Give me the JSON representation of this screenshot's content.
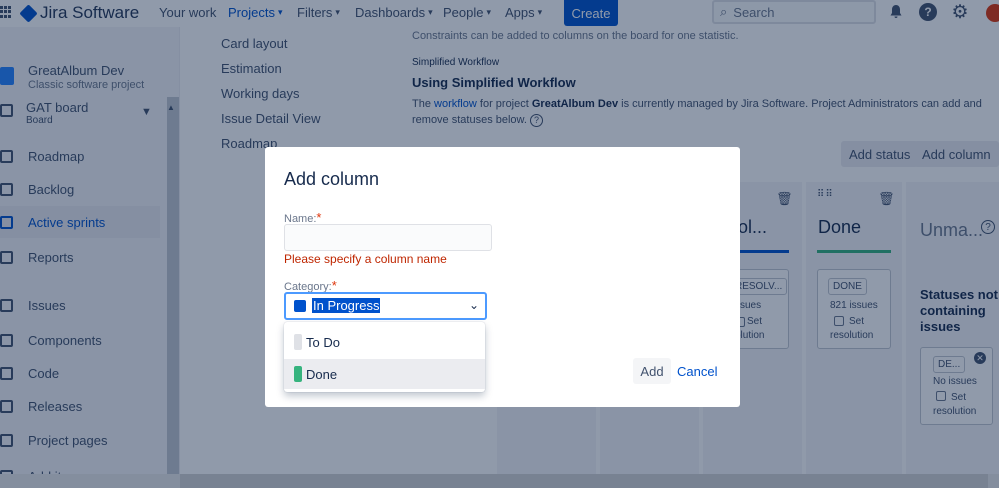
{
  "topnav": {
    "app_name": "Jira Software",
    "items": [
      {
        "label": "Your work",
        "chevron": false
      },
      {
        "label": "Projects",
        "chevron": true,
        "active": true
      },
      {
        "label": "Filters",
        "chevron": true
      },
      {
        "label": "Dashboards",
        "chevron": true
      },
      {
        "label": "People",
        "chevron": true
      },
      {
        "label": "Apps",
        "chevron": true
      }
    ],
    "create_label": "Create",
    "search_placeholder": "Search",
    "help_label": "?"
  },
  "sidebar": {
    "project_name": "GreatAlbum Dev",
    "project_type": "Classic software project",
    "board_name": "GAT board",
    "board_sub": "Board",
    "items": [
      {
        "label": "Roadmap",
        "icon": "roadmap-icon"
      },
      {
        "label": "Backlog",
        "icon": "backlog-icon"
      },
      {
        "label": "Active sprints",
        "icon": "active-sprints-icon",
        "active": true
      },
      {
        "label": "Reports",
        "icon": "reports-icon"
      },
      {
        "label": "Issues",
        "icon": "issues-icon"
      },
      {
        "label": "Components",
        "icon": "components-icon"
      },
      {
        "label": "Code",
        "icon": "code-icon"
      },
      {
        "label": "Releases",
        "icon": "releases-icon"
      },
      {
        "label": "Project pages",
        "icon": "project-pages-icon"
      },
      {
        "label": "Add item",
        "icon": "add-item-icon"
      }
    ]
  },
  "settings_nav": [
    "Card layout",
    "Estimation",
    "Working days",
    "Issue Detail View",
    "Roadmap"
  ],
  "main": {
    "top_note": "Constraints can be added to columns on the board for one statistic.",
    "section_label": "Simplified Workflow",
    "heading": "Using Simplified Workflow",
    "desc_pre": "The",
    "desc_link": "workflow",
    "desc_mid": "for project",
    "desc_project": "GreatAlbum Dev",
    "desc_post": "is currently managed by Jira Software. Project Administrators can add and remove statuses below.",
    "add_status_label": "Add status",
    "add_column_label": "Add column"
  },
  "columns": {
    "resolved_title_fragment": "ol...",
    "resolved_status_label": "RESOLV...",
    "resolved_issues": "ssues",
    "resolved_set_label": "Set",
    "resolved_set_sub": "olution",
    "done_title": "Done",
    "done_status_label": "DONE",
    "done_issues": "821 issues",
    "done_set_label": "Set",
    "done_set_sub": "resolution",
    "unmapped_title": "Unma...",
    "unmapped_help": "?",
    "unmapped_heading": "Statuses not containing issues",
    "unmapped_status_label": "DE...",
    "unmapped_issues": "No issues",
    "unmapped_set_label": "Set",
    "unmapped_set_sub": "resolution"
  },
  "modal": {
    "title": "Add column",
    "name_label": "Name:",
    "required_mark": "*",
    "name_value": "",
    "name_error": "Please specify a column name",
    "category_label": "Category:",
    "category_value": "In Progress",
    "category_options": [
      {
        "label": "To Do",
        "color": "#dfe1e6"
      },
      {
        "label": "Done",
        "color": "#36b37e"
      }
    ],
    "add_label": "Add",
    "cancel_label": "Cancel"
  },
  "colors": {
    "brand": "#0052cc",
    "error": "#bf2600",
    "done_green": "#36b37e",
    "in_progress_blue": "#0052cc"
  }
}
